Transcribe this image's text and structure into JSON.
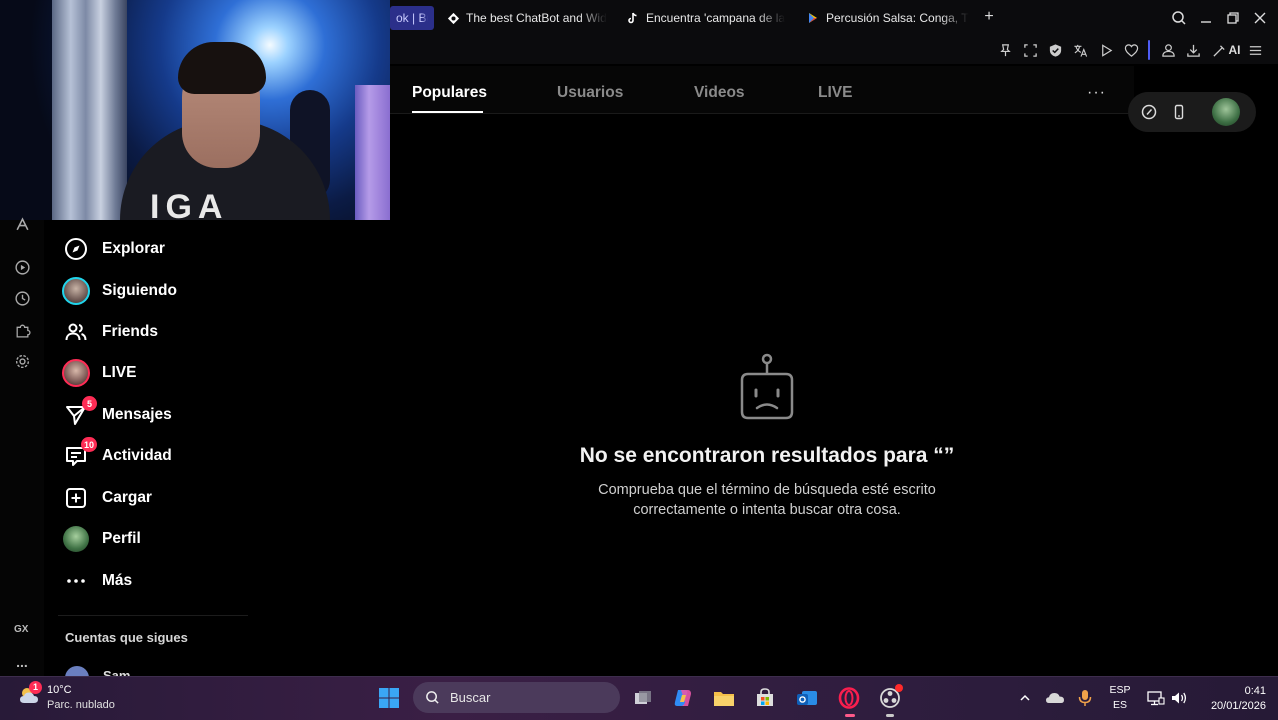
{
  "browser": {
    "tabs": [
      {
        "title": "ok | Bu",
        "favicon": "tiktok-icon",
        "active": true
      },
      {
        "title": "The best ChatBot and Wid",
        "favicon": "chatbot-icon",
        "active": false
      },
      {
        "title": "Encuentra 'campana de la",
        "favicon": "tiktok-icon",
        "active": false
      },
      {
        "title": "Percusión Salsa: Conga, T",
        "favicon": "play-store-icon",
        "active": false
      }
    ],
    "new_tab_label": "+",
    "toolbar_ai_label": "AI",
    "accent": "#4f5df5"
  },
  "opera_sidebar": {
    "icons": [
      "extension-icon",
      "player-icon",
      "history-icon",
      "puzzle-icon",
      "settings-icon"
    ],
    "gx_label": "GX",
    "more_label": "..."
  },
  "nav": {
    "items": [
      {
        "label": "Explorar",
        "icon": "compass-icon",
        "badge": ""
      },
      {
        "label": "Siguiendo",
        "icon": "following-avatar",
        "badge": ""
      },
      {
        "label": "Friends",
        "icon": "friends-icon",
        "badge": ""
      },
      {
        "label": "LIVE",
        "icon": "live-avatar",
        "badge": ""
      },
      {
        "label": "Mensajes",
        "icon": "paper-plane-icon",
        "badge": "5"
      },
      {
        "label": "Actividad",
        "icon": "message-box-icon",
        "badge": "10"
      },
      {
        "label": "Cargar",
        "icon": "plus-square-icon",
        "badge": ""
      },
      {
        "label": "Perfil",
        "icon": "profile-avatar",
        "badge": ""
      },
      {
        "label": "Más",
        "icon": "more-dots-icon",
        "badge": ""
      }
    ],
    "following_title": "Cuentas que sigues",
    "following_first": "Sam"
  },
  "results": {
    "tabs": [
      "Populares",
      "Usuarios",
      "Videos",
      "LIVE"
    ],
    "active_tab": "Populares",
    "more_label": "···",
    "empty_title": "No se encontraron resultados para “”",
    "empty_sub": "Comprueba que el término de búsqueda esté escrito correctamente o intenta buscar otra cosa."
  },
  "taskbar": {
    "weather_temp": "10°C",
    "weather_desc": "Parc. nublado",
    "weather_badge": "1",
    "search_placeholder": "Buscar",
    "lang_top": "ESP",
    "lang_bottom": "ES",
    "time": "0:41",
    "date": "20/01/2026",
    "brand_color": "#fe2c55"
  }
}
